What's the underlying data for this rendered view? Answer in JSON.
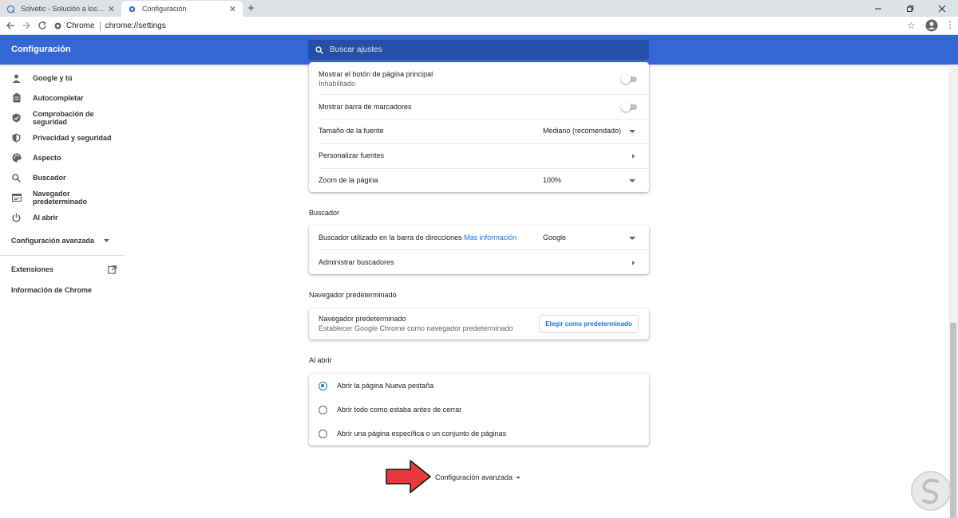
{
  "tabs": [
    {
      "title": "Solvetic - Solución a los problemas",
      "active": false
    },
    {
      "title": "Configuración",
      "active": true
    }
  ],
  "address": {
    "site": "Chrome",
    "url": "chrome://settings"
  },
  "header": {
    "title": "Configuración",
    "search_placeholder": "Buscar ajustes"
  },
  "sidebar": {
    "items": [
      {
        "label": "Google y tú",
        "icon": "person-icon"
      },
      {
        "label": "Autocompletar",
        "icon": "clipboard-icon"
      },
      {
        "label": "Comprobación de seguridad",
        "icon": "shield-check-icon"
      },
      {
        "label": "Privacidad y seguridad",
        "icon": "shield-icon"
      },
      {
        "label": "Aspecto",
        "icon": "palette-icon"
      },
      {
        "label": "Buscador",
        "icon": "search-icon"
      },
      {
        "label": "Navegador predeterminado",
        "icon": "browser-icon"
      },
      {
        "label": "Al abrir",
        "icon": "power-icon"
      }
    ],
    "advanced": "Configuración avanzada",
    "extensions": "Extensiones",
    "about": "Información de Chrome"
  },
  "appearance": {
    "home_button": {
      "label": "Mostrar el botón de página principal",
      "sub": "Inhabilitado",
      "enabled": false
    },
    "bookmarks_bar": {
      "label": "Mostrar barra de marcadores",
      "enabled": false
    },
    "font_size": {
      "label": "Tamaño de la fuente",
      "value": "Mediano (recomendado)"
    },
    "custom_fonts": {
      "label": "Personalizar fuentes"
    },
    "zoom": {
      "label": "Zoom de la página",
      "value": "100%"
    }
  },
  "search_engine": {
    "title": "Buscador",
    "engine": {
      "label": "Buscador utilizado en la barra de direcciones",
      "link": "Más información",
      "value": "Google"
    },
    "manage": {
      "label": "Administrar buscadores"
    }
  },
  "default_browser": {
    "title": "Navegador predeterminado",
    "label": "Navegador predeterminado",
    "sub": "Establecer Google Chrome como navegador predeterminado",
    "button": "Elegir como predeterminado"
  },
  "on_startup": {
    "title": "Al abrir",
    "options": [
      {
        "label": "Abrir la página Nueva pestaña",
        "selected": true
      },
      {
        "label": "Abrir todo como estaba antes de cerrar",
        "selected": false
      },
      {
        "label": "Abrir una página específica o un conjunto de páginas",
        "selected": false
      }
    ]
  },
  "advanced_button": "Configuración avanzada",
  "colors": {
    "header": "#3367d6",
    "accent": "#1a73e8",
    "arrow": "#e8383d"
  }
}
